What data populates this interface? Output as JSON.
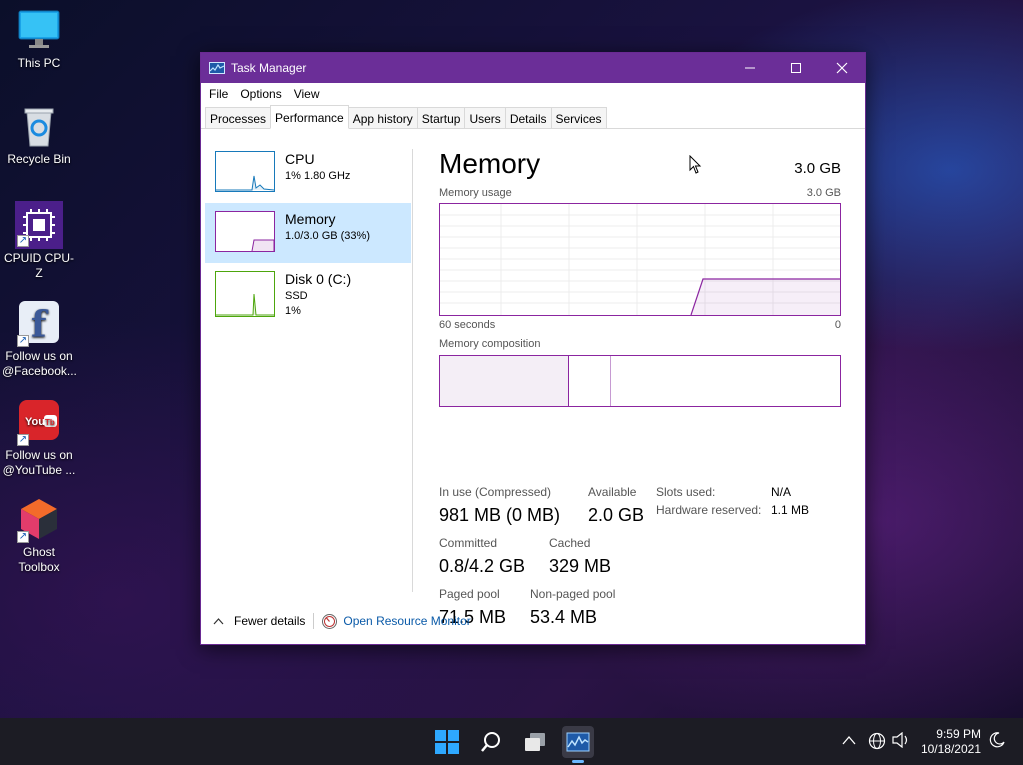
{
  "desktop": {
    "icons": [
      {
        "label": "This PC",
        "icon": "monitor-icon"
      },
      {
        "label": "Recycle Bin",
        "icon": "recycle-bin-icon"
      },
      {
        "label": "CPUID CPU-Z",
        "icon": "cpu-z-icon"
      },
      {
        "label": "Follow us on @Facebook...",
        "line1": "Follow us on",
        "line2": "@Facebook...",
        "icon": "facebook-icon"
      },
      {
        "label": "Follow us on @YouTube ...",
        "line1": "Follow us on",
        "line2": "@YouTube ...",
        "icon": "youtube-icon"
      },
      {
        "label": "Ghost Toolbox",
        "line1": "Ghost",
        "line2": "Toolbox",
        "icon": "ghost-toolbox-icon"
      }
    ]
  },
  "window": {
    "title": "Task Manager",
    "title_color": "#6b2e98",
    "menu": [
      "File",
      "Options",
      "View"
    ],
    "tabs": [
      "Processes",
      "Performance",
      "App history",
      "Startup",
      "Users",
      "Details",
      "Services"
    ],
    "active_tab": "Performance"
  },
  "left_pane": {
    "items": [
      {
        "name": "CPU",
        "line2": "1% 1.80 GHz",
        "line3": "",
        "color": "#1779ba"
      },
      {
        "name": "Memory",
        "line2": "1.0/3.0 GB (33%)",
        "line3": "",
        "color": "#8b25a0",
        "selected": true
      },
      {
        "name": "Disk 0 (C:)",
        "line2": "SSD",
        "line3": "1%",
        "color": "#4da60c"
      }
    ]
  },
  "memory": {
    "title": "Memory",
    "total": "3.0 GB",
    "usage_label": "Memory usage",
    "usage_max": "3.0 GB",
    "axis_left": "60 seconds",
    "axis_right": "0",
    "composition_label": "Memory composition",
    "usage_fraction": 0.33,
    "stats": {
      "in_use_label": "In use (Compressed)",
      "in_use_value": "981 MB (0 MB)",
      "available_label": "Available",
      "available_value": "2.0 GB",
      "committed_label": "Committed",
      "committed_value": "0.8/4.2 GB",
      "cached_label": "Cached",
      "cached_value": "329 MB",
      "paged_label": "Paged pool",
      "paged_value": "71.5 MB",
      "nonpaged_label": "Non-paged pool",
      "nonpaged_value": "53.4 MB",
      "slots_label": "Slots used:",
      "slots_value": "N/A",
      "hw_label": "Hardware reserved:",
      "hw_value": "1.1 MB"
    }
  },
  "footer": {
    "fewer_details": "Fewer details",
    "open_monitor": "Open Resource Monitor"
  },
  "taskbar": {
    "time": "9:59 PM",
    "date": "10/18/2021"
  }
}
